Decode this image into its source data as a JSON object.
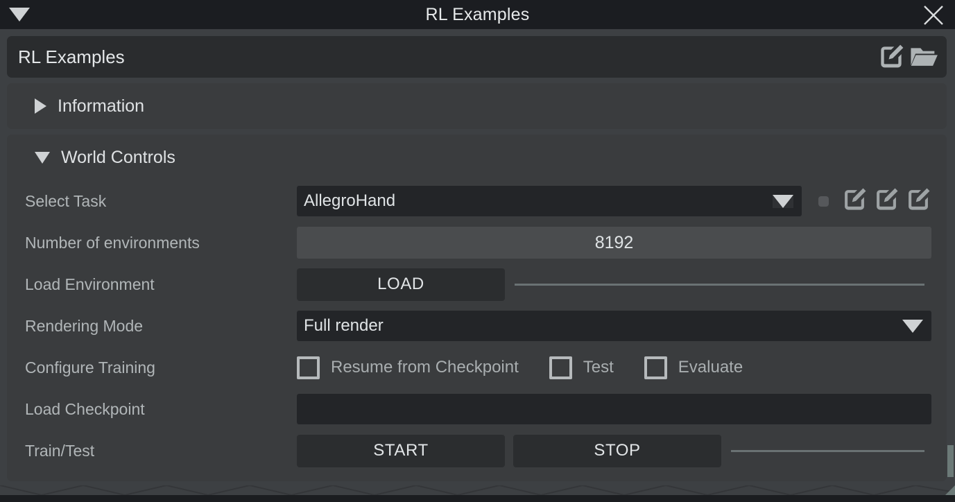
{
  "window": {
    "title": "RL Examples",
    "collapse_icon": "triangle-down-icon",
    "close_icon": "close-icon"
  },
  "namebar": {
    "text": "RL Examples",
    "edit_icon": "edit-pencil-icon",
    "folder_icon": "folder-open-icon"
  },
  "sections": [
    {
      "id": "information",
      "title": "Information",
      "expanded": false,
      "caret_icon": "triangle-right-icon"
    },
    {
      "id": "world-controls",
      "title": "World Controls",
      "expanded": true,
      "caret_icon": "triangle-down-icon"
    }
  ],
  "world_controls": {
    "select_task": {
      "label": "Select Task",
      "value": "AllegroHand",
      "dropdown_icon": "chevron-down-icon",
      "status_dot": "status-dot",
      "edit_icons": [
        "edit-pencil-icon",
        "edit-pencil-icon",
        "edit-pencil-icon"
      ]
    },
    "num_environments": {
      "label": "Number of environments",
      "value": "8192"
    },
    "load_environment": {
      "label": "Load Environment",
      "button": "LOAD"
    },
    "rendering_mode": {
      "label": "Rendering Mode",
      "value": "Full render",
      "dropdown_icon": "chevron-down-icon"
    },
    "configure_training": {
      "label": "Configure Training",
      "checkboxes": [
        {
          "label": "Resume from Checkpoint",
          "checked": false
        },
        {
          "label": "Test",
          "checked": false
        },
        {
          "label": "Evaluate",
          "checked": false
        }
      ]
    },
    "load_checkpoint": {
      "label": "Load Checkpoint",
      "value": "",
      "placeholder": ""
    },
    "train_test": {
      "label": "Train/Test",
      "start_button": "START",
      "stop_button": "STOP"
    }
  },
  "colors": {
    "window_bg": "#3d4043",
    "titlebar_bg": "#1b1d21",
    "panel_bg": "#3a3c3e",
    "field_dark": "#232528",
    "field_light": "#4a4c4e",
    "button_bg": "#2b2d2f",
    "text_primary": "#e4e7e9",
    "text_label": "#b1b6b8",
    "scrollbar": "#6c7a78"
  }
}
